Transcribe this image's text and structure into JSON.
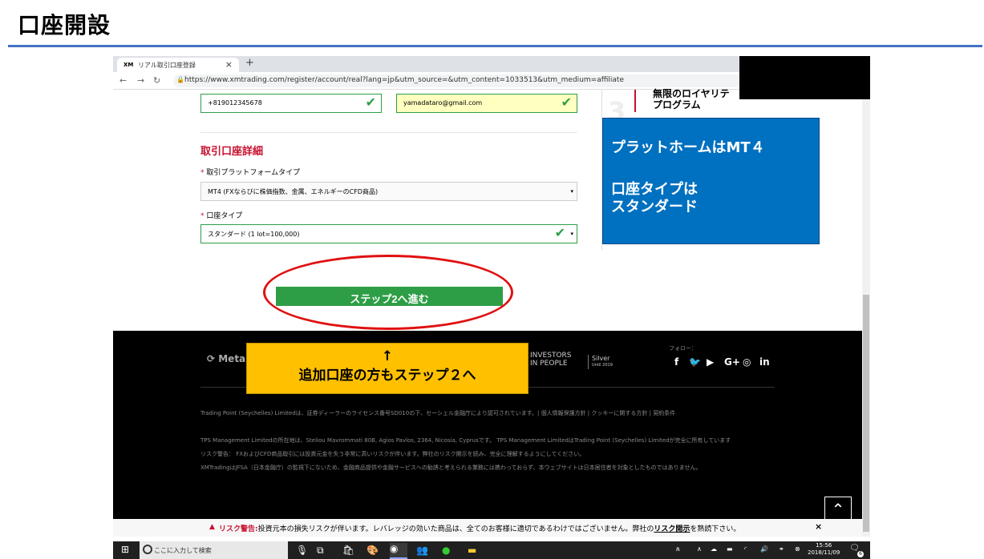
{
  "slide": {
    "title": "口座開設"
  },
  "browser": {
    "tab_title": "リアル取引口座登録",
    "tab_favicon": "XM",
    "tab_close": "×",
    "new_tab": "+",
    "url": "https://www.xmtrading.com/register/account/real?lang=jp&utm_source=&utm_content=1033513&utm_medium=affiliate"
  },
  "form": {
    "phone_value": "+819012345678",
    "email_value": "yamadataro@gmail.com",
    "section_title": "取引口座詳細",
    "platform_label": "取引プラットフォームタイプ",
    "platform_value": "MT4 (FXならびに株価指数、金属、エネルギーのCFD商品)",
    "account_type_label": "口座タイプ",
    "account_type_value": "スタンダード (1 lot=100,000)",
    "required_mark": "*",
    "check_mark": "✔",
    "select_arrow": "▾",
    "next_button": "ステップ2へ進む"
  },
  "sidebar": {
    "number": "3",
    "text_line1": "無限のロイヤリテ",
    "text_line2": "プログラム"
  },
  "callouts": {
    "blue_line1": "プラットホームはMT４",
    "blue_line2": "口座タイプは",
    "blue_line3": "スタンダード",
    "yellow_arrow": "↑",
    "yellow_text": "追加口座の方もステップ２へ"
  },
  "footer": {
    "logo_left": "⟳ Meta",
    "investors_line1": "INVESTORS",
    "investors_line2": "IN PEOPLE",
    "investors_silver": "Silver",
    "investors_until": "Until 2019",
    "follow_label": "フォロー：",
    "social": [
      "f",
      "🐦",
      "▶",
      "G+",
      "◎",
      "in"
    ],
    "legal_line1": "Trading Point (Seychelles) Limitedは、証券ディーラーのライセンス番号SD010の下、セーシェル金融庁により認可されています。| 個人情報保護方針 | クッキーに関する方針 | 契約条件",
    "legal_line2": "TPS Management Limitedの所在地は、Steliou Mavrommati 80B, Agios Pavlos, 2364, Nicosia, Cyprusです。 TPS Management LimitedはTrading Point (Seychelles) Limitedが完全に所有しています",
    "legal_line3": "リスク警告： FXおよびCFD商品取引には投資元金を失う非常に高いリスクが伴います。弊社のリスク開示を読み、完全に理解するようにしてください。",
    "legal_line4": "XMTradingはJFSA（日本金融庁）の監視下にないため、金融商品提供や金融サービスへの勧誘と考えられる業務には携わっておらず、本ウェブサイトは日本居住者を対象としたものではありません。",
    "scroll_top": "⌃"
  },
  "risk_bar": {
    "icon": "▲",
    "label": "リスク警告:",
    "text": "投資元本の損失リスクが伴います。レバレッジの効いた商品は、全てのお客様に適切であるわけではございません。弊社の",
    "link": "リスク開示",
    "suffix": "を熟読下さい。",
    "close": "×"
  },
  "taskbar": {
    "search_placeholder": "ここに入力して検索",
    "time": "15:56",
    "date": "2018/11/09",
    "notification_count": "6"
  }
}
